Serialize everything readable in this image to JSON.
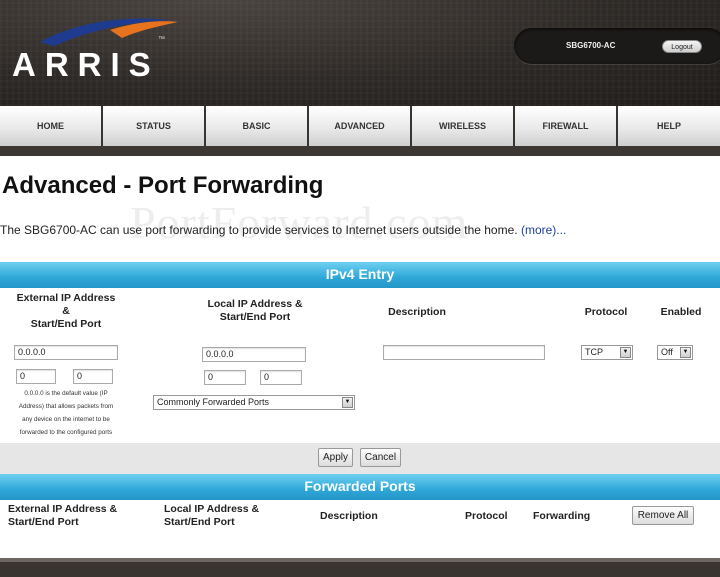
{
  "header": {
    "brand": "ARRIS",
    "trademark": "™",
    "device_name": "SBG6700-AC",
    "logout_label": "Logout",
    "colors": {
      "swoosh_blue": "#1e3b8f",
      "swoosh_orange": "#e8731f"
    }
  },
  "nav": {
    "items": [
      {
        "label": "HOME"
      },
      {
        "label": "STATUS"
      },
      {
        "label": "BASIC"
      },
      {
        "label": "ADVANCED"
      },
      {
        "label": "WIRELESS"
      },
      {
        "label": "FIREWALL"
      },
      {
        "label": "HELP"
      }
    ]
  },
  "page": {
    "title": "Advanced - Port Forwarding",
    "watermark": "PortForward.com",
    "intro": "The SBG6700-AC can use port forwarding to provide services to Internet users outside the home.",
    "more_link": "(more)...",
    "accent_color": "#2ea7d8"
  },
  "ipv4": {
    "title": "IPv4 Entry",
    "headers": {
      "external_line1": "External IP Address",
      "external_line2": "&",
      "external_line3": "Start/End Port",
      "local_line1": "Local IP Address &",
      "local_line2": "Start/End Port",
      "description": "Description",
      "protocol": "Protocol",
      "enabled": "Enabled"
    },
    "external_ip": "0.0.0.0",
    "external_start": "0",
    "external_end": "0",
    "hint_lines": [
      "0.0.0.0 is the default value (IP",
      "Address) that allows packets from",
      "any device on the internet to be",
      "forwarded to the configured ports"
    ],
    "local_ip": "0.0.0.0",
    "local_start": "0",
    "local_end": "0",
    "common_ports": "Commonly Forwarded Ports",
    "description_value": "",
    "protocol_value": "TCP",
    "enabled_value": "Off",
    "apply_label": "Apply",
    "cancel_label": "Cancel"
  },
  "forwarded": {
    "title": "Forwarded Ports",
    "headers": {
      "external_line1": "External IP Address &",
      "external_line2": "Start/End Port",
      "local_line1": "Local IP Address &",
      "local_line2": "Start/End Port",
      "description": "Description",
      "protocol": "Protocol",
      "forwarding": "Forwarding"
    },
    "remove_all_label": "Remove All"
  }
}
